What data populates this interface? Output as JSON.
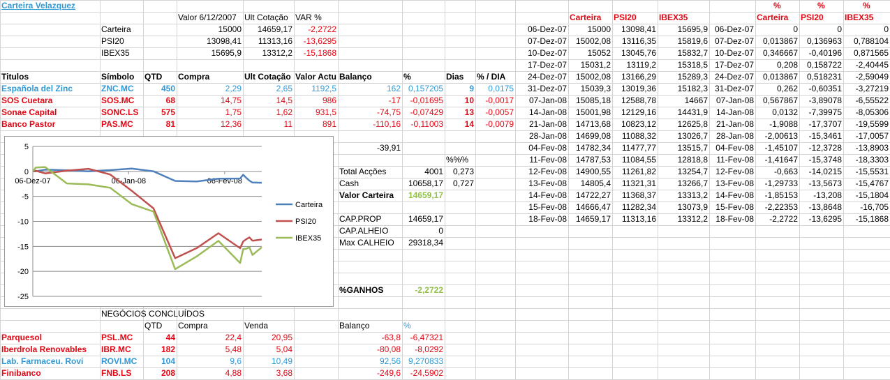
{
  "sheet_title": "Carteira Velazquez",
  "top_summary": {
    "headers": [
      "Valor 6/12/2007",
      "Ult Cotação",
      "VAR %"
    ],
    "rows": [
      {
        "label": "Carteira",
        "v": "15000",
        "u": "14659,17",
        "p": "-2,2722"
      },
      {
        "label": "PSI20",
        "v": "13098,41",
        "u": "11313,16",
        "p": "-13,6295"
      },
      {
        "label": "IBEX35",
        "v": "15695,9",
        "u": "13312,2",
        "p": "-15,1868"
      }
    ]
  },
  "holdings": {
    "headers": [
      "Titulos",
      "Símbolo",
      "QTD",
      "Compra",
      "Ult Cotação",
      "Valor Actual",
      "Balanço",
      "%",
      "Dias",
      "% / DIA"
    ],
    "rows": [
      {
        "name": "Española del Zinc",
        "sym": "ZNC.MC",
        "qtd": "450",
        "compra": "2,29",
        "ult": "2,65",
        "valor": "1192,5",
        "bal": "162",
        "pct": "0,157205",
        "dias": "9",
        "pdia": "0,0175",
        "color": "#2e9ad7"
      },
      {
        "name": "SOS Cuetara",
        "sym": "SOS.MC",
        "qtd": "68",
        "compra": "14,75",
        "ult": "14,5",
        "valor": "986",
        "bal": "-17",
        "pct": "-0,01695",
        "dias": "10",
        "pdia": "-0,0017",
        "color": "#e30613"
      },
      {
        "name": "Sonae Capital",
        "sym": "SONC.LS",
        "qtd": "575",
        "compra": "1,75",
        "ult": "1,62",
        "valor": "931,5",
        "bal": "-74,75",
        "pct": "-0,07429",
        "dias": "13",
        "pdia": "-0,0057",
        "color": "#e30613"
      },
      {
        "name": "Banco Pastor",
        "sym": "PAS.MC",
        "qtd": "81",
        "compra": "12,36",
        "ult": "11",
        "valor": "891",
        "bal": "-110,16",
        "pct": "-0,11003",
        "dias": "14",
        "pdia": "-0,0079",
        "color": "#e30613"
      }
    ],
    "total_balanco": "-39,91",
    "pct_header": "%%%"
  },
  "totals": {
    "total_accoes_label": "Total Acções",
    "total_accoes": "4001",
    "total_accoes_pct": "0,273",
    "cash_label": "Cash",
    "cash": "10658,17",
    "cash_pct": "0,727",
    "valor_carteira_label": "Valor Carteira",
    "valor_carteira": "14659,17",
    "cap_prop_label": "CAP.PROP",
    "cap_prop": "14659,17",
    "cap_alheio_label": "CAP.ALHEIO",
    "cap_alheio": "0",
    "max_calheio_label": "Max CALHEIO",
    "max_calheio": "29318,34",
    "ganhos_label": "%GANHOS",
    "ganhos": "-2,2722"
  },
  "closed_deals": {
    "title": "NEGÓCIOS CONCLUÍDOS",
    "headers": [
      "QTD",
      "Compra",
      "Venda",
      "Balanço",
      "%"
    ],
    "rows": [
      {
        "name": "Parquesol",
        "sym": "PSL.MC",
        "qtd": "44",
        "compra": "22,4",
        "venda": "20,95",
        "bal": "-63,8",
        "pct": "-6,47321",
        "color": "#e30613"
      },
      {
        "name": "Iberdrola Renovables",
        "sym": "IBR.MC",
        "qtd": "182",
        "compra": "5,48",
        "venda": "5,04",
        "bal": "-80,08",
        "pct": "-8,0292",
        "color": "#e30613"
      },
      {
        "name": "Lab. Farmaceu. Rovi",
        "sym": "ROVI.MC",
        "qtd": "104",
        "compra": "9,6",
        "venda": "10,49",
        "bal": "92,56",
        "pct": "9,270833",
        "color": "#2e9ad7"
      },
      {
        "name": "Finibanco",
        "sym": "FNB.LS",
        "qtd": "208",
        "compra": "4,88",
        "venda": "3,68",
        "bal": "-249,6",
        "pct": "-24,5902",
        "color": "#e30613"
      }
    ]
  },
  "history": {
    "headers": [
      "Carteira",
      "PSI20",
      "IBEX35"
    ],
    "pct_headers": [
      "%",
      "%",
      "%"
    ],
    "rows": [
      {
        "date": "06-Dez-07",
        "c": "15000",
        "p": "13098,41",
        "i": "15695,9",
        "date2": "06-Dez-07",
        "pc": "0",
        "pp": "0",
        "pi": "0"
      },
      {
        "date": "07-Dez-07",
        "c": "15002,08",
        "p": "13116,35",
        "i": "15819,6",
        "date2": "07-Dez-07",
        "pc": "0,013867",
        "pp": "0,136963",
        "pi": "0,788104"
      },
      {
        "date": "10-Dez-07",
        "c": "15052",
        "p": "13045,76",
        "i": "15832,7",
        "date2": "10-Dez-07",
        "pc": "0,346667",
        "pp": "-0,40196",
        "pi": "0,871565"
      },
      {
        "date": "17-Dez-07",
        "c": "15031,2",
        "p": "13119,2",
        "i": "15318,5",
        "date2": "17-Dez-07",
        "pc": "0,208",
        "pp": "0,158722",
        "pi": "-2,40445"
      },
      {
        "date": "24-Dez-07",
        "c": "15002,08",
        "p": "13166,29",
        "i": "15289,3",
        "date2": "24-Dez-07",
        "pc": "0,013867",
        "pp": "0,518231",
        "pi": "-2,59049"
      },
      {
        "date": "31-Dez-07",
        "c": "15039,3",
        "p": "13019,36",
        "i": "15182,3",
        "date2": "31-Dez-07",
        "pc": "0,262",
        "pp": "-0,60351",
        "pi": "-3,27219"
      },
      {
        "date": "07-Jan-08",
        "c": "15085,18",
        "p": "12588,78",
        "i": "14667",
        "date2": "07-Jan-08",
        "pc": "0,567867",
        "pp": "-3,89078",
        "pi": "-6,55522"
      },
      {
        "date": "14-Jan-08",
        "c": "15001,98",
        "p": "12129,16",
        "i": "14431,9",
        "date2": "14-Jan-08",
        "pc": "0,0132",
        "pp": "-7,39975",
        "pi": "-8,05306"
      },
      {
        "date": "21-Jan-08",
        "c": "14713,68",
        "p": "10823,12",
        "i": "12625,8",
        "date2": "21-Jan-08",
        "pc": "-1,9088",
        "pp": "-17,3707",
        "pi": "-19,5599"
      },
      {
        "date": "28-Jan-08",
        "c": "14699,08",
        "p": "11088,32",
        "i": "13026,7",
        "date2": "28-Jan-08",
        "pc": "-2,00613",
        "pp": "-15,3461",
        "pi": "-17,0057"
      },
      {
        "date": "04-Fev-08",
        "c": "14782,34",
        "p": "11477,77",
        "i": "13515,7",
        "date2": "04-Fev-08",
        "pc": "-1,45107",
        "pp": "-12,3728",
        "pi": "-13,8903"
      },
      {
        "date": "11-Fev-08",
        "c": "14787,53",
        "p": "11084,55",
        "i": "12818,8",
        "date2": "11-Fev-08",
        "pc": "-1,41647",
        "pp": "-15,3748",
        "pi": "-18,3303"
      },
      {
        "date": "12-Fev-08",
        "c": "14900,55",
        "p": "11261,82",
        "i": "13254,7",
        "date2": "12-Fev-08",
        "pc": "-0,663",
        "pp": "-14,0215",
        "pi": "-15,5531"
      },
      {
        "date": "13-Fev-08",
        "c": "14805,4",
        "p": "11321,31",
        "i": "13266,7",
        "date2": "13-Fev-08",
        "pc": "-1,29733",
        "pp": "-13,5673",
        "pi": "-15,4767"
      },
      {
        "date": "14-Fev-08",
        "c": "14722,27",
        "p": "11368,37",
        "i": "13313,2",
        "date2": "14-Fev-08",
        "pc": "-1,85153",
        "pp": "-13,208",
        "pi": "-15,1804"
      },
      {
        "date": "15-Fev-08",
        "c": "14666,47",
        "p": "11282,34",
        "i": "13073,9",
        "date2": "15-Fev-08",
        "pc": "-2,22353",
        "pp": "-13,8648",
        "pi": "-16,705"
      },
      {
        "date": "18-Fev-08",
        "c": "14659,17",
        "p": "11313,16",
        "i": "13312,2",
        "date2": "18-Fev-08",
        "pc": "-2,2722",
        "pp": "-13,6295",
        "pi": "-15,1868"
      }
    ]
  },
  "chart_data": {
    "type": "line",
    "x": [
      "2007-12-06",
      "2007-12-07",
      "2007-12-10",
      "2007-12-17",
      "2007-12-24",
      "2007-12-31",
      "2008-01-07",
      "2008-01-14",
      "2008-01-21",
      "2008-01-28",
      "2008-02-04",
      "2008-02-11",
      "2008-02-12",
      "2008-02-13",
      "2008-02-14",
      "2008-02-15",
      "2008-02-18"
    ],
    "x_tick_labels": [
      "06-Dez-07",
      "06-Jan-08",
      "06-Fev-08"
    ],
    "x_tick_dates": [
      "2007-12-06",
      "2008-01-06",
      "2008-02-06"
    ],
    "ylim": [
      -25,
      5
    ],
    "y_ticks": [
      5,
      0,
      -5,
      -10,
      -15,
      -20,
      -25
    ],
    "legend_position": "right",
    "series": [
      {
        "name": "Carteira",
        "color": "#4f81bd",
        "values": [
          0,
          0.013867,
          0.346667,
          0.208,
          0.013867,
          0.262,
          0.567867,
          0.0132,
          -1.9088,
          -2.00613,
          -1.45107,
          -1.41647,
          -0.663,
          -1.29733,
          -1.85153,
          -2.22353,
          -2.2722
        ]
      },
      {
        "name": "PSI20",
        "color": "#c0504d",
        "values": [
          0,
          0.136963,
          -0.40196,
          0.158722,
          0.518231,
          -0.60351,
          -3.89078,
          -7.39975,
          -17.3707,
          -15.3461,
          -12.3728,
          -15.3748,
          -14.0215,
          -13.5673,
          -13.208,
          -13.8648,
          -13.6295
        ]
      },
      {
        "name": "IBEX35",
        "color": "#9bbb59",
        "values": [
          0,
          0.788104,
          0.871565,
          -2.40445,
          -2.59049,
          -3.27219,
          -6.55522,
          -8.05306,
          -19.5599,
          -17.0057,
          -13.8903,
          -18.3303,
          -15.5531,
          -15.4767,
          -15.1804,
          -16.705,
          -15.1868
        ]
      }
    ]
  }
}
